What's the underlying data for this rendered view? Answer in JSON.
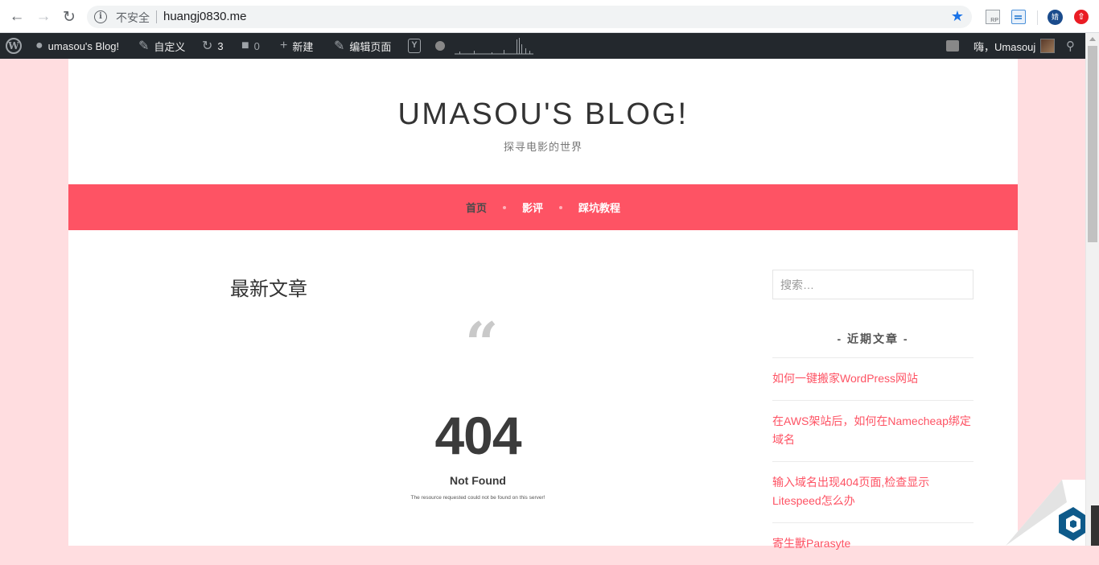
{
  "browser": {
    "insecure_label": "不安全",
    "url": "huangj0830.me",
    "rp_ext_label": "RP",
    "profile_label": "婧"
  },
  "adminbar": {
    "site_name": "umasou's Blog!",
    "customize": "自定义",
    "updates_count": "3",
    "comments_count": "0",
    "new": "新建",
    "edit_page": "编辑页面",
    "greeting": "嗨，Umasouj"
  },
  "site": {
    "title": "UMASOU'S BLOG!",
    "description": "探寻电影的世界"
  },
  "nav": {
    "items": [
      {
        "label": "首页"
      },
      {
        "label": "影评"
      },
      {
        "label": "踩坑教程"
      }
    ]
  },
  "main": {
    "title": "最新文章",
    "error_code": "404",
    "error_title": "Not Found",
    "error_detail": "The resource requested could not be found on this server!"
  },
  "sidebar": {
    "search_placeholder": "搜索…",
    "recent_title": "- 近期文章 -",
    "recent_posts": [
      {
        "label": "如何一键搬家WordPress网站"
      },
      {
        "label": "在AWS架站后，如何在Namecheap绑定域名"
      },
      {
        "label": "输入域名出现404页面,检查显示Litespeed怎么办"
      },
      {
        "label": "寄生獸Parasyte"
      }
    ]
  },
  "colors": {
    "accent": "#fe5364",
    "background": "#ffdde0",
    "adminbar": "#23282d"
  }
}
